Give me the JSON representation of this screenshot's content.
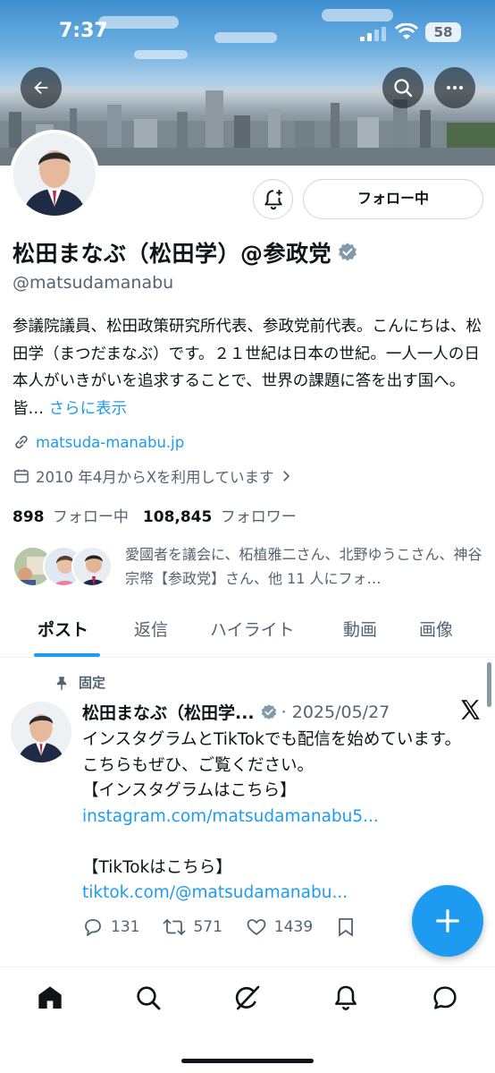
{
  "status_bar": {
    "time": "7:37",
    "battery": "58"
  },
  "header": {
    "back_label": "Back",
    "search_label": "Search",
    "more_label": "More"
  },
  "profile": {
    "display_name": "松田まなぶ（松田学）@参政党",
    "handle": "@matsudamanabu",
    "bio": "参議院議員、松田政策研究所代表、参政党前代表。こんにちは、松田学（まつだまなぶ）です。２１世紀は日本の世紀。一人一人の日本人がいきがいを追求することで、世界の課題に答を出す国へ。皆…",
    "bio_more": "さらに表示",
    "website": "matsuda-manabu.jp",
    "joined": "2010 年4月からXを利用しています",
    "following_count": "898",
    "following_label": "フォロー中",
    "followers_count": "108,845",
    "followers_label": "フォロワー",
    "follow_button": "フォロー中",
    "known_followers": "愛國者を議会に、柘植雅二さん、北野ゆうこさん、神谷宗幣【参政党】さん、他 11 人にフォ…"
  },
  "tabs": [
    "ポスト",
    "返信",
    "ハイライト",
    "動画",
    "画像"
  ],
  "pinned_post": {
    "pinned_label": "固定",
    "author": "松田まなぶ（松田学...",
    "date": "· 2025/05/27",
    "text_1": "インスタグラムとTikTokでも配信を始めています。こちらもぜひ、ご覧ください。\n【インスタグラムはこちら】",
    "link_1": "instagram.com/matsudamanabu5...",
    "text_2": "【TikTokはこちら】",
    "link_2": "tiktok.com/@matsudamanabu...",
    "replies": "131",
    "reposts": "571",
    "likes": "1439"
  },
  "colors": {
    "accent": "#1d9bf0",
    "text": "#0f1419",
    "muted": "#536471",
    "verified": "#829aab"
  },
  "icons": [
    "back-arrow-icon",
    "search-icon",
    "more-icon",
    "notify-plus-icon",
    "verified-badge-icon",
    "link-icon",
    "calendar-icon",
    "chevron-right-icon",
    "pin-icon",
    "x-logo-icon",
    "reply-icon",
    "repost-icon",
    "like-icon",
    "compose-plus-icon",
    "home-icon",
    "explore-icon",
    "grok-icon",
    "notifications-icon",
    "messages-icon"
  ]
}
